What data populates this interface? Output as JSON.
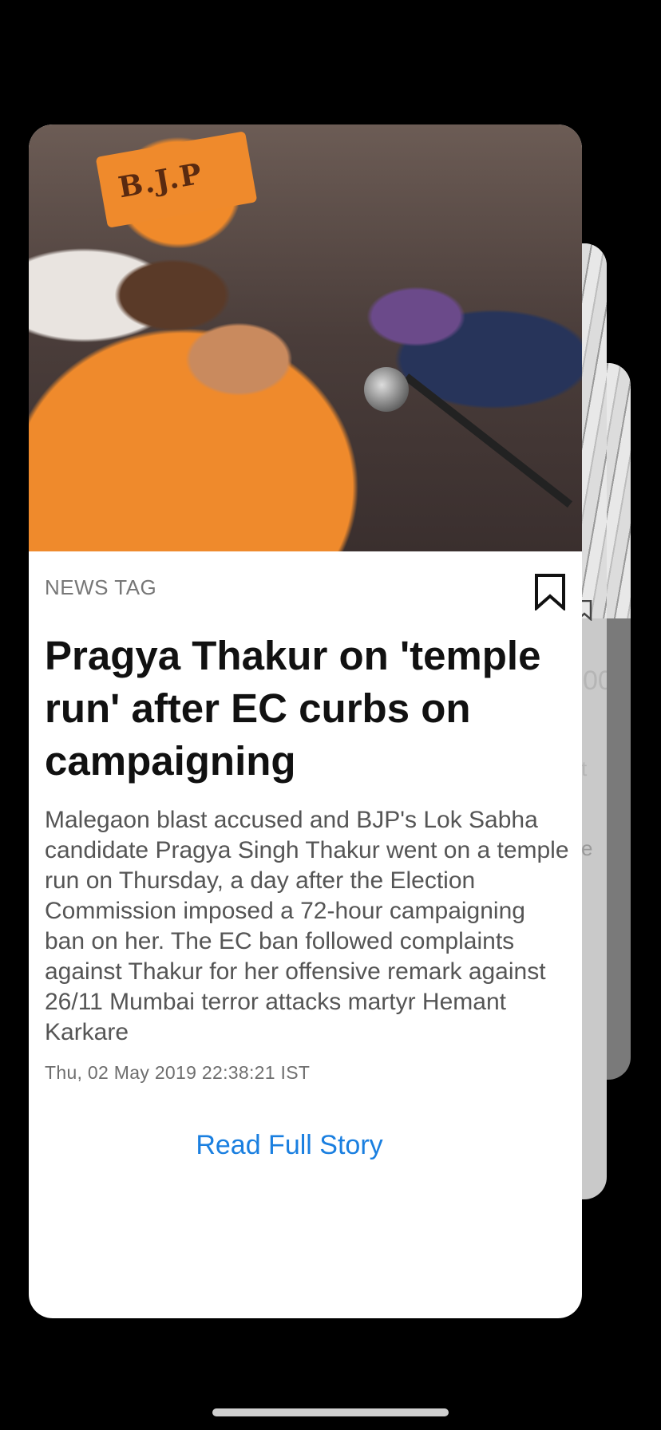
{
  "story": {
    "tag": "NEWS TAG",
    "title": "Pragya Thakur on 'temple run' after EC curbs on campaigning",
    "summary": "Malegaon blast accused and BJP's Lok Sabha candidate Pragya Singh Thakur went on a temple run on Thursday, a day after the Election Commission imposed a 72-hour campaigning ban on her. The EC ban followed complaints against Thakur for her offensive remark against 26/11 Mumbai terror attacks martyr Hemant Karkare",
    "timestamp": "Thu, 02 May 2019 22:38:21 IST",
    "read_full_story": "Read Full Story",
    "image_caption_text": "B.J.P",
    "link_color": "#1a7fe0",
    "bookmark_icon": "bookmark-outline-icon"
  },
  "background_cards": {
    "peek_text_1": "00",
    "peek_text_2": "t",
    "peek_text_3": "e"
  }
}
